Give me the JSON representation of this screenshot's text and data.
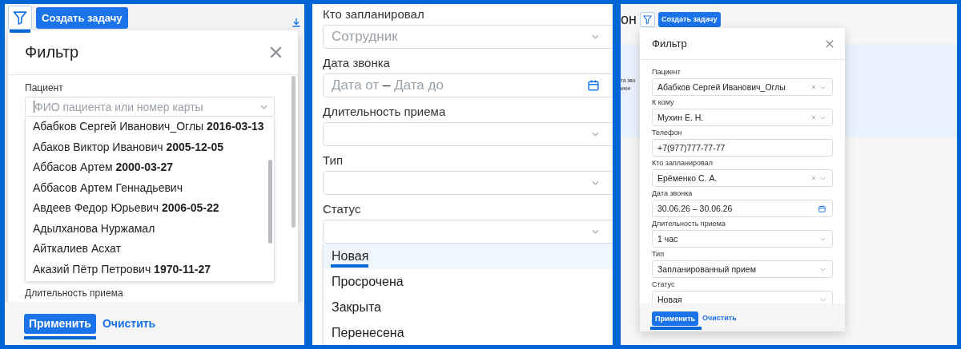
{
  "panels": [
    {
      "kind": "patient_dropdown",
      "toolbar": {
        "filter_highlighted": true,
        "create_label": "Создать задачу"
      },
      "modal": {
        "title": "Фильтр",
        "fields": [
          {
            "kind": "select",
            "label": "Пациент",
            "placeholder": "ФИО пациента или номер карты",
            "focused": true,
            "options": [
              {
                "label": "Абабков Сергей Иванович_Оглы **2016-03-13**"
              },
              {
                "label": "Абаков Виктор Иванович **2005-12-05**"
              },
              {
                "label": "Аббасов Артем **2000-03-27**"
              },
              {
                "label": "Аббасов Артем Геннадьевич"
              },
              {
                "label": "Авдеев Федор Юрьевич **2006-05-22**"
              },
              {
                "label": "Адылханова Нуржамал"
              },
              {
                "label": "Айткалиев Асхат"
              },
              {
                "label": "Аказий Пётр Петрович **1970-11-27**"
              }
            ]
          },
          {
            "kind": "label_only",
            "label": "Длительность приема"
          }
        ],
        "apply": {
          "label": "Применить",
          "highlighted": true
        },
        "clear_label": "Очистить"
      }
    },
    {
      "kind": "form_part",
      "fields": [
        {
          "kind": "select",
          "label": "Кто запланировал",
          "placeholder": "Сотрудник"
        },
        {
          "kind": "date",
          "label": "Дата звонка",
          "placeholder_from": "Дата от",
          "separator": "–",
          "placeholder_to": "Дата до"
        },
        {
          "kind": "select",
          "label": "Длительность приема"
        },
        {
          "kind": "select",
          "label": "Тип"
        },
        {
          "kind": "select",
          "label": "Статус",
          "options": [
            {
              "label": "Новая",
              "selected": true
            },
            {
              "label": "Просрочена",
              "selected": false
            },
            {
              "label": "Закрыта",
              "selected": false
            },
            {
              "label": "Перенесена",
              "selected": false
            }
          ]
        }
      ]
    },
    {
      "kind": "filled_form",
      "background_text": [
        {
          "text": "он",
          "kind": "heading"
        },
        {
          "text": "та зво",
          "kind": "small"
        },
        {
          "text": "июн",
          "kind": "small"
        }
      ],
      "toolbar": {
        "create_label": "Создать задачу"
      },
      "modal": {
        "title": "Фильтр",
        "fields": [
          {
            "kind": "select",
            "label": "Пациент",
            "value": "Абабков Сергей Иванович_Оглы",
            "clearable": true
          },
          {
            "kind": "select",
            "label": "К кому",
            "value": "Мухин Е. Н.",
            "clearable": true
          },
          {
            "kind": "text",
            "label": "Телефон",
            "value": "+7(977)777-77-77"
          },
          {
            "kind": "select",
            "label": "Кто запланировал",
            "value": "Ерёменко С. А.",
            "clearable": true
          },
          {
            "kind": "date",
            "label": "Дата звонка",
            "value": "30.06.26 – 30.06.26"
          },
          {
            "kind": "select",
            "label": "Длительность приема",
            "value": "1 час"
          },
          {
            "kind": "select",
            "label": "Тип",
            "value": "Запланированный прием"
          },
          {
            "kind": "select",
            "label": "Статус",
            "value": "Новая"
          }
        ],
        "apply": {
          "label": "Применить",
          "highlighted": true
        },
        "clear_label": "Очистить"
      }
    }
  ]
}
